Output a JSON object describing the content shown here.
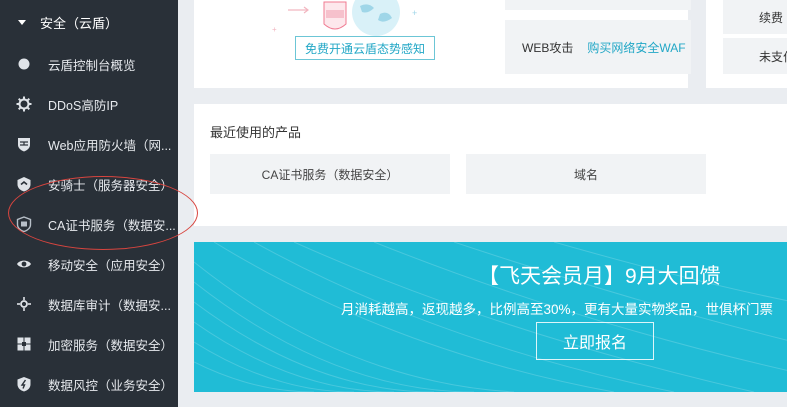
{
  "sidebar": {
    "header": "安全（云盾）",
    "items": [
      {
        "label": "云盾控制台概览",
        "icon": "dot-icon"
      },
      {
        "label": "DDoS高防IP",
        "icon": "gear-icon"
      },
      {
        "label": "Web应用防火墙（网...",
        "icon": "firewall-icon"
      },
      {
        "label": "安骑士（服务器安全）",
        "icon": "shield-icon"
      },
      {
        "label": "CA证书服务（数据安...",
        "icon": "certificate-icon"
      },
      {
        "label": "移动安全（应用安全）",
        "icon": "eye-icon"
      },
      {
        "label": "数据库审计（数据安...",
        "icon": "database-audit-icon"
      },
      {
        "label": "加密服务（数据安全）",
        "icon": "puzzle-icon"
      },
      {
        "label": "数据风控（业务安全）",
        "icon": "risk-control-icon"
      }
    ]
  },
  "top": {
    "promo_link": "免费开通云盾态势感知",
    "waf_label": "WEB攻击",
    "waf_link": "购买网络安全WAF",
    "right_label_1": "续费",
    "right_label_2": "未支付"
  },
  "recent": {
    "title": "最近使用的产品",
    "items": [
      "CA证书服务（数据安全）",
      "域名"
    ]
  },
  "banner": {
    "title": "【飞天会员月】9月大回馈",
    "subtitle": "月消耗越高，返现越多，比例高至30%，更有大量实物奖品，世俱杯门票",
    "button": "立即报名"
  },
  "colors": {
    "sidebar_bg": "#293038",
    "accent": "#22a7c6",
    "banner_bg": "#20bcd6",
    "annotation": "#d8453f"
  }
}
